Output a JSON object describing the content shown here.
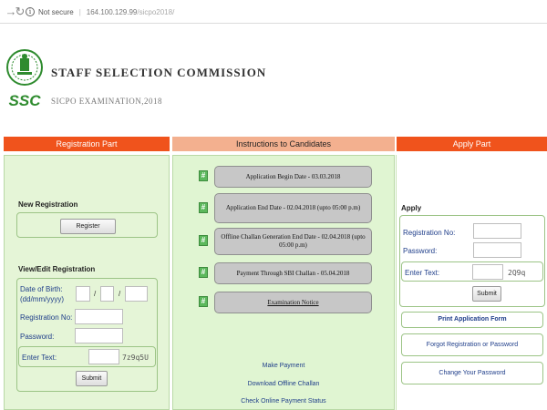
{
  "browser": {
    "security_label": "Not secure",
    "url_host": "164.100.129.99",
    "url_path": "/sicpo2018/"
  },
  "header": {
    "title": "STAFF SELECTION COMMISSION",
    "subtitle": "SICPO EXAMINATION,2018",
    "logo_text": "SSC"
  },
  "sections": {
    "registration": "Registration Part",
    "instructions": "Instructions to Candidates",
    "apply": "Apply Part"
  },
  "registration": {
    "new_heading": "New Registration",
    "register_button": "Register",
    "edit_heading": "View/Edit Registration",
    "dob_label": "Date of Birth:",
    "dob_format": "(dd/mm/yyyy)",
    "date_sep": "/",
    "regno_label": "Registration No:",
    "password_label": "Password:",
    "enter_text_label": "Enter Text:",
    "captcha": "7z9q5U",
    "submit_button": "Submit"
  },
  "instructions": {
    "items": [
      "Application Begin Date - 03.03.2018",
      "Application End Date - 02.04.2018 (upto 05:00 p.m)",
      "Offline Challan Generation End Date - 02.04.2018 (upto 05:00 p.m)",
      "Payment Through SBI Challan - 05.04.2018",
      "Examination Notice"
    ],
    "bullet": "#",
    "links": [
      "Make Payment",
      "Download Offline Challan",
      "Check Online Payment Status"
    ]
  },
  "apply": {
    "heading": "Apply",
    "regno_label": "Registration No:",
    "password_label": "Password:",
    "enter_text_label": "Enter Text:",
    "captcha": "2Q9q",
    "submit_button": "Submit",
    "print_link": "Print Application Form",
    "forgot_link": "Forgot Registration or Password",
    "change_link": "Change Your Password"
  },
  "colors": {
    "header_red": "#f0531c",
    "header_salmon": "#f3b08f",
    "panel_green": "#e5f5d7",
    "link_blue": "#1f3e8a"
  }
}
